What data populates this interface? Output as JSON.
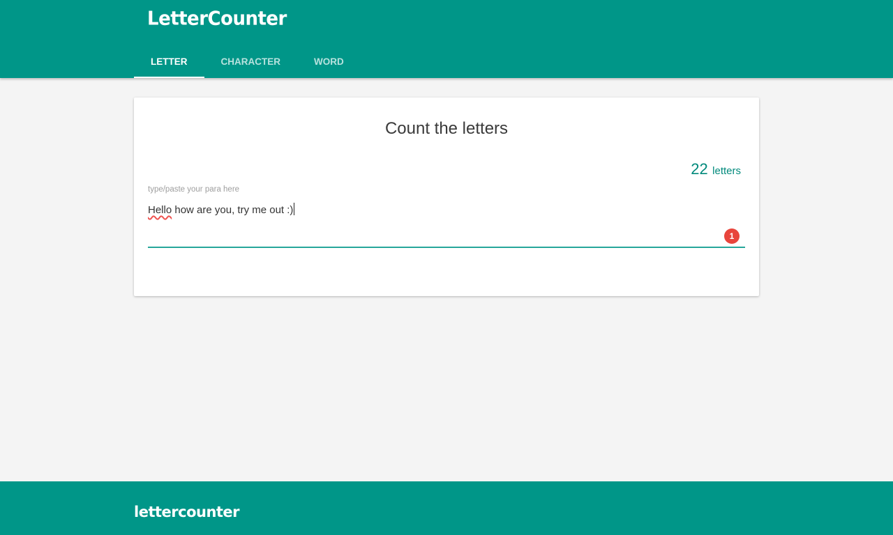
{
  "app": {
    "brand": "LetterCounter",
    "accent_color": "#009688"
  },
  "nav": {
    "tabs": [
      {
        "label": "LETTER",
        "active": true
      },
      {
        "label": "CHARACTER",
        "active": false
      },
      {
        "label": "WORD",
        "active": false
      }
    ]
  },
  "card": {
    "title": "Count the letters",
    "count_value": "22",
    "count_unit": "letters",
    "field_label": "type/paste your para here",
    "text_misspelled_word": "Hello",
    "text_rest": " how are you, try me out :)",
    "badge_count": "1",
    "badge_color": "#e8453c"
  },
  "footer": {
    "brand": "lettercounter"
  }
}
